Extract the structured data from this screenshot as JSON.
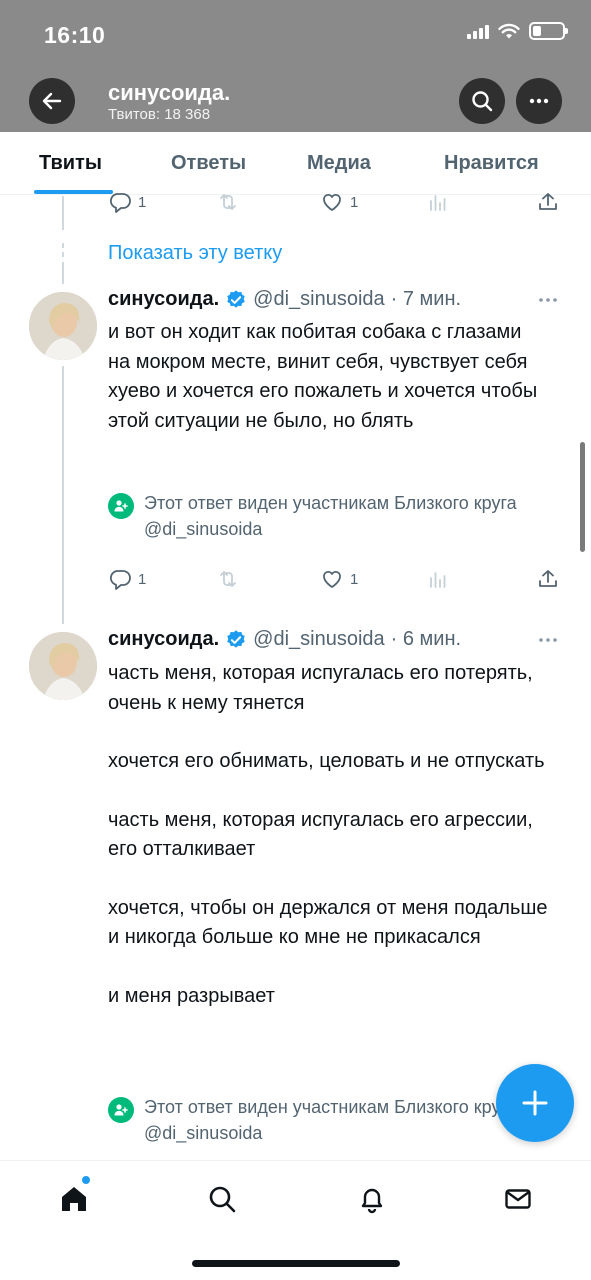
{
  "status_bar": {
    "time": "16:10"
  },
  "header": {
    "profile_name": "синусоида.",
    "tweet_count": "Твитов: 18 368"
  },
  "tabs": [
    {
      "label": "Твиты",
      "active": true
    },
    {
      "label": "Ответы",
      "active": false
    },
    {
      "label": "Медиа",
      "active": false
    },
    {
      "label": "Нравится",
      "active": false
    }
  ],
  "prev_tweet_actions": {
    "replies": "1",
    "likes": "1"
  },
  "show_thread_link": "Показать эту ветку",
  "tweets": [
    {
      "name": "синусоида.",
      "handle": "@di_sinusoida",
      "time": "· 7 мин.",
      "paragraphs": [
        "и вот он ходит как побитая собака с глазами на мокром месте, винит себя, чувствует себя хуево и хочется его пожалеть и хочется чтобы этой ситуации не было, но блять"
      ],
      "circle_note": "Этот ответ виден участникам Близкого круга @di_sinusoida",
      "replies": "1",
      "likes": "1"
    },
    {
      "name": "синусоида.",
      "handle": "@di_sinusoida",
      "time": "· 6 мин.",
      "paragraphs": [
        "часть меня, которая испугалась его потерять, очень к нему тянется",
        "хочется его обнимать, целовать и не отпускать",
        "часть меня, которая испугалась его агрессии, его отталкивает",
        "хочется, чтобы он держался от меня подальше и никогда больше ко мне не прикасался",
        "и меня разрывает"
      ],
      "circle_note": "Этот ответ виден участникам Близкого круга @di_sinusoida"
    }
  ],
  "colors": {
    "accent": "#1d9bf0",
    "circle_green": "#00ba7c",
    "header_bg": "#8a8a8a"
  },
  "icons": {
    "bottom_nav": [
      "home-icon",
      "search-icon",
      "bell-icon",
      "mail-icon"
    ],
    "fab": "plus-icon"
  }
}
